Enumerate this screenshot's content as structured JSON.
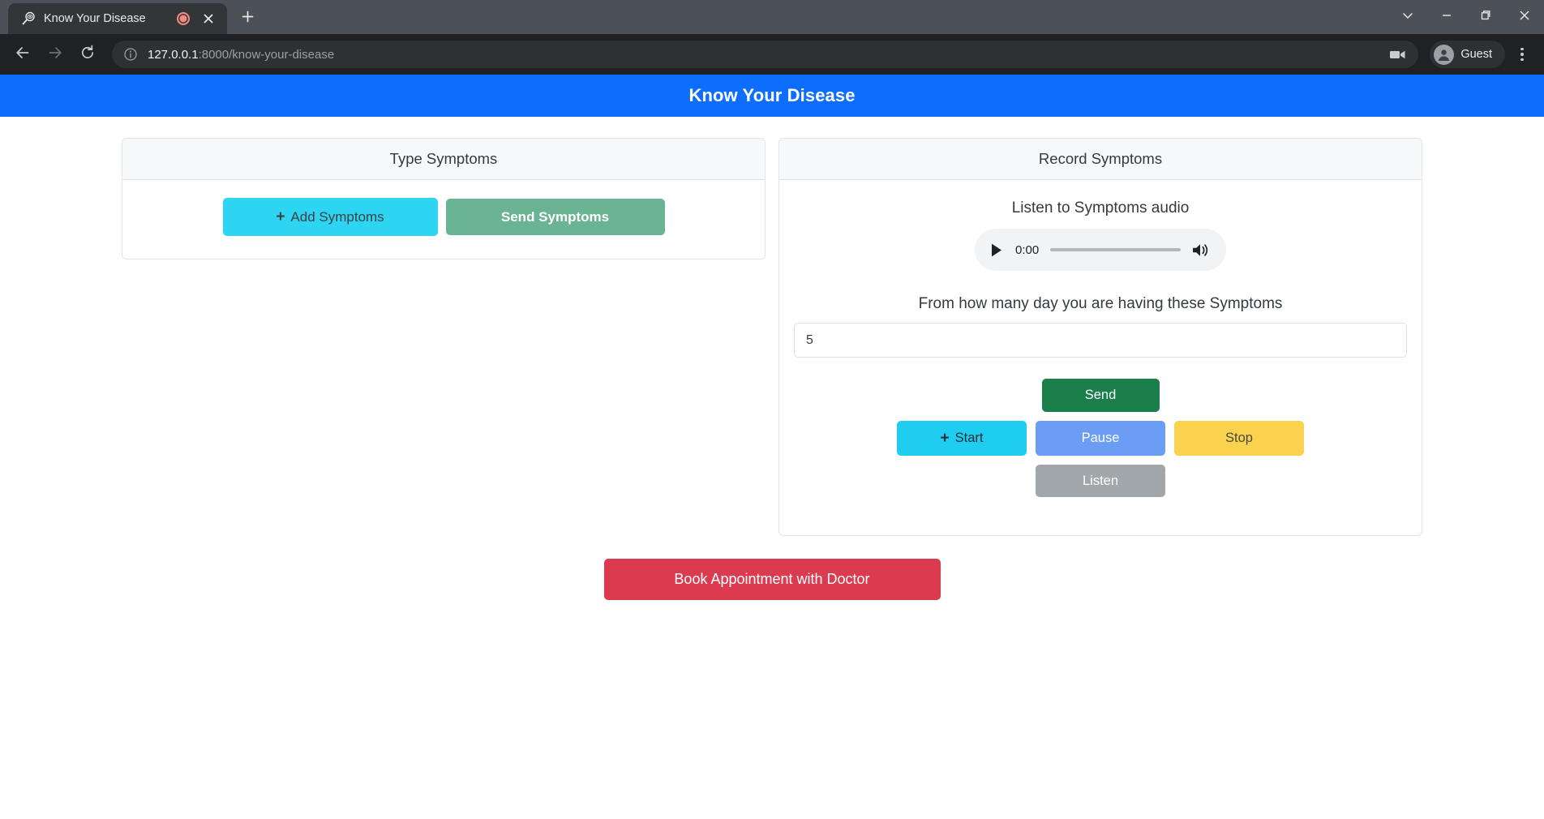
{
  "browser": {
    "tab": {
      "title": "Know Your Disease",
      "favicon_icon": "magnifier-eye-icon",
      "recording_indicator_icon": "recording-dot-icon",
      "close_icon": "close-icon"
    },
    "new_tab_icon": "plus-icon",
    "window_controls": {
      "tab_search_icon": "chevron-down-icon",
      "minimize_icon": "minimize-icon",
      "maximize_icon": "maximize-icon",
      "close_icon": "close-icon"
    },
    "toolbar": {
      "back_icon": "arrow-left-icon",
      "forward_icon": "arrow-right-icon",
      "reload_icon": "reload-icon",
      "site_info_icon": "info-circle-icon",
      "url_host": "127.0.0.1",
      "url_rest": ":8000/know-your-disease",
      "media_capture_icon": "video-camera-icon",
      "profile_name": "Guest",
      "profile_avatar_icon": "user-avatar-icon",
      "menu_icon": "three-dots-menu-icon"
    }
  },
  "app": {
    "banner_title": "Know Your Disease",
    "banner_color": "#0d6efd"
  },
  "type_symptoms_card": {
    "header": "Type Symptoms",
    "add_button": {
      "label": "Add Symptoms",
      "icon": "plus-icon",
      "color": "#2ed5f2"
    },
    "send_button": {
      "label": "Send Symptoms",
      "color": "#6ab393"
    }
  },
  "record_symptoms_card": {
    "header": "Record Symptoms",
    "audio_label": "Listen to Symptoms audio",
    "audio_player": {
      "play_icon": "play-icon",
      "current_time": "0:00",
      "volume_icon": "volume-icon"
    },
    "days_label": "From how many day you are having these Symptoms",
    "days_value": "5",
    "days_placeholder": "",
    "controls": {
      "send": {
        "label": "Send",
        "color": "#1a7f4b"
      },
      "start": {
        "label": "Start",
        "icon": "plus-icon",
        "color": "#1fcdf0"
      },
      "pause": {
        "label": "Pause",
        "color": "#6b9df5"
      },
      "stop": {
        "label": "Stop",
        "color": "#fbd24e"
      },
      "listen": {
        "label": "Listen",
        "color": "#a2a7ac"
      }
    }
  },
  "footer": {
    "book_button": {
      "label": "Book Appointment with Doctor",
      "color": "#dc3a4f"
    }
  }
}
